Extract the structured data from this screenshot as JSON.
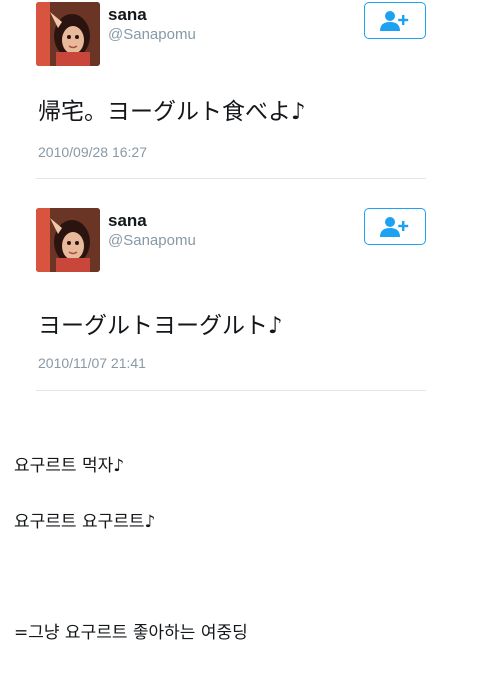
{
  "tweets": [
    {
      "name": "sana",
      "handle": "@Sanapomu",
      "text": "帰宅。ヨーグルト食べよ♪",
      "timestamp": "2010/09/28 16:27",
      "follow_icon": "follow-user-icon"
    },
    {
      "name": "sana",
      "handle": "@Sanapomu",
      "text": "ヨーグルトヨーグルト♪",
      "timestamp": "2010/11/07 21:41",
      "follow_icon": "follow-user-icon"
    }
  ],
  "captions": [
    "요구르트 먹자♪",
    "요구르트 요구르트♪",
    "=그냥 요구르트 좋아하는 여중딩"
  ],
  "colors": {
    "accent": "#1da1f2",
    "text": "#14171a",
    "muted": "#8899a6",
    "divider": "#e1e8ed"
  }
}
